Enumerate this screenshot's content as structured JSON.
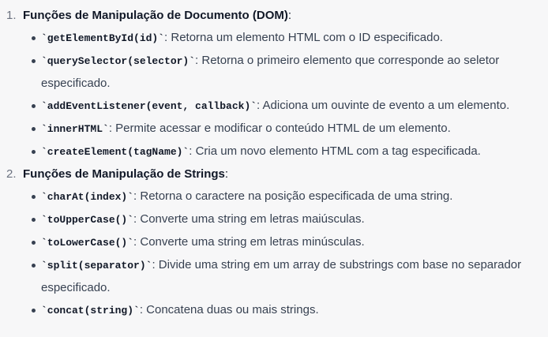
{
  "sections": [
    {
      "number": "1.",
      "title": "Funções de Manipulação de Documento (DOM)",
      "suffix": ":",
      "items": [
        {
          "code": "`getElementById(id)`",
          "text": ": Retorna um elemento HTML com o ID especificado."
        },
        {
          "code": "`querySelector(selector)`",
          "text": ": Retorna o primeiro elemento que corresponde ao seletor especificado."
        },
        {
          "code": "`addEventListener(event, callback)`",
          "text": ": Adiciona um ouvinte de evento a um elemento."
        },
        {
          "code": "`innerHTML`",
          "text": ": Permite acessar e modificar o conteúdo HTML de um elemento."
        },
        {
          "code": "`createElement(tagName)`",
          "text": ": Cria um novo elemento HTML com a tag especificada."
        }
      ]
    },
    {
      "number": "2.",
      "title": "Funções de Manipulação de Strings",
      "suffix": ":",
      "items": [
        {
          "code": "`charAt(index)`",
          "text": ": Retorna o caractere na posição especificada de uma string."
        },
        {
          "code": "`toUpperCase()`",
          "text": ": Converte uma string em letras maiúsculas."
        },
        {
          "code": "`toLowerCase()`",
          "text": ": Converte uma string em letras minúsculas."
        },
        {
          "code": "`split(separator)`",
          "text": ": Divide uma string em um array de substrings com base no separador especificado."
        },
        {
          "code": "`concat(string)`",
          "text": ": Concatena duas ou mais strings."
        }
      ]
    }
  ]
}
